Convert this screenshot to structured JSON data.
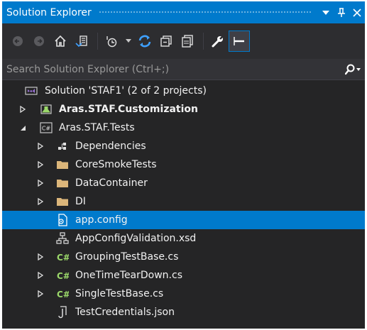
{
  "window": {
    "title": "Solution Explorer",
    "buttons": {
      "dropdown": "▼",
      "pin": "ᵾ",
      "close": "✕"
    }
  },
  "toolbar": {
    "items": [
      "back-icon",
      "forward-icon",
      "home-icon",
      "switch-views-icon",
      "pending-changes-filter-icon",
      "sync-with-document-icon",
      "collapse-all-icon",
      "show-all-files-icon",
      "properties-icon",
      "preview-selected-icon"
    ]
  },
  "search": {
    "placeholder": "Search Solution Explorer (Ctrl+;)"
  },
  "tree": {
    "solution": "Solution 'STAF1' (2 of 2 projects)",
    "project_customization": "Aras.STAF.Customization",
    "project_tests": "Aras.STAF.Tests",
    "dependencies": "Dependencies",
    "core_smoke_tests": "CoreSmokeTests",
    "data_container": "DataContainer",
    "di": "DI",
    "app_config": "app.config",
    "app_config_validation": "AppConfigValidation.xsd",
    "grouping_test_base": "GroupingTestBase.cs",
    "one_time_tear_down": "OneTimeTearDown.cs",
    "single_test_base": "SingleTestBase.cs",
    "test_credentials": "TestCredentials.json",
    "csharp_badge": "C#"
  },
  "colors": {
    "accent": "#007acc",
    "panel_bg": "#252526",
    "toolbar_bg": "#2d2d30",
    "folder": "#dcb67a",
    "csharp": "#9bd86a"
  }
}
